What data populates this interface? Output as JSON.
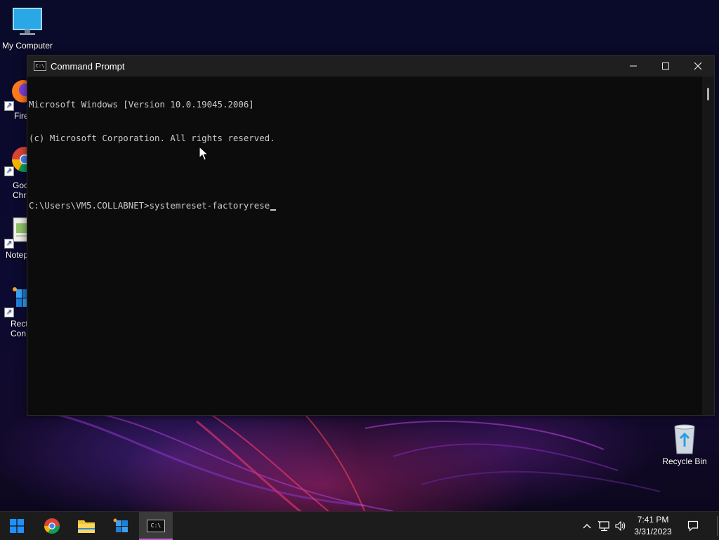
{
  "desktop": {
    "icons": [
      {
        "label": "My Computer"
      },
      {
        "label": "Fire"
      },
      {
        "label": "Goo",
        "label2": "Chr"
      },
      {
        "label": "Notep"
      },
      {
        "label": "Rect",
        "label2": "Con"
      },
      {
        "label": "Recycle Bin"
      }
    ]
  },
  "window": {
    "title": "Command Prompt",
    "icon_text": "C:\\",
    "controls": {
      "minimize": "minimize-icon",
      "maximize": "maximize-icon",
      "close": "close-icon"
    }
  },
  "console": {
    "lines": [
      "Microsoft Windows [Version 10.0.19045.2006]",
      "(c) Microsoft Corporation. All rights reserved.",
      "",
      "C:\\Users\\VM5.COLLABNET>systemreset-factoryrese"
    ]
  },
  "taskbar": {
    "apps": [
      "start-icon",
      "chrome-icon",
      "file-explorer-icon",
      "rect-app-icon",
      "command-prompt-icon"
    ],
    "active_app_text": "C:\\",
    "time": "7:41 PM",
    "date": "3/31/2023"
  },
  "colors": {
    "console_bg": "#0c0c0c",
    "console_text": "#cccccc",
    "titlebar": "#1f1f1f",
    "taskbar": "#1c1c1c",
    "accent": "#c85cd8"
  }
}
